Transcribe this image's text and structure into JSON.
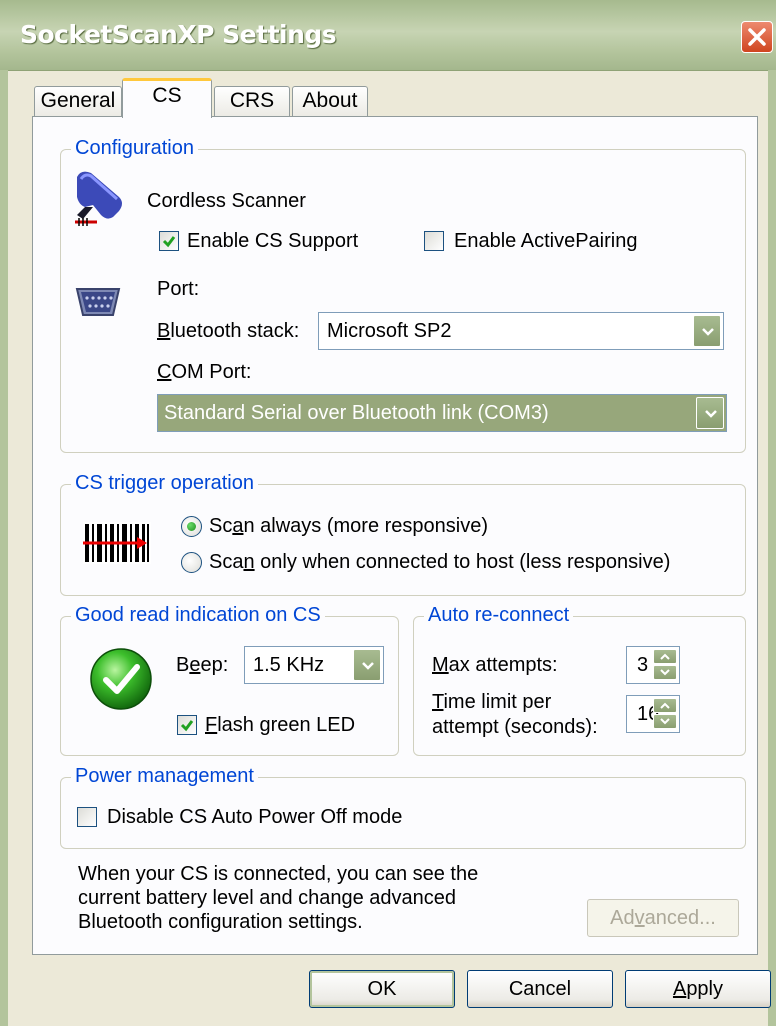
{
  "window": {
    "title": "SocketScanXP Settings",
    "close_icon": "close-icon"
  },
  "tabs": [
    {
      "label": "General",
      "active": false
    },
    {
      "label": "CS",
      "active": true
    },
    {
      "label": "CRS",
      "active": false
    },
    {
      "label": "About",
      "active": false
    }
  ],
  "configuration": {
    "title": "Configuration",
    "scanner_icon": "cordless-scanner-icon",
    "scanner_label": "Cordless Scanner",
    "enable_cs_support": {
      "label": "Enable CS Support",
      "checked": true
    },
    "enable_active_pairing": {
      "label": "Enable ActivePairing",
      "checked": false
    },
    "port_icon": "serial-port-icon",
    "port_label": "Port:",
    "bt_stack_label": "Bluetooth stack:",
    "bt_stack_value": "Microsoft SP2",
    "com_port_label": "COM Port:",
    "com_port_value": "Standard Serial over Bluetooth link (COM3)"
  },
  "trigger": {
    "title": "CS trigger operation",
    "barcode_icon": "barcode-scan-icon",
    "options": [
      {
        "label": "Scan always (more responsive)",
        "selected": true
      },
      {
        "label": "Scan only when connected to host (less responsive)",
        "selected": false
      }
    ]
  },
  "good_read": {
    "title": "Good read indication on CS",
    "icon": "green-check-icon",
    "beep_label": "Beep:",
    "beep_value": "1.5 KHz",
    "flash_led": {
      "label": "Flash green LED",
      "checked": true
    }
  },
  "auto_reconnect": {
    "title": "Auto re-connect",
    "max_attempts_label": "Max attempts:",
    "max_attempts_value": "3",
    "time_limit_label_1": "Time limit per",
    "time_limit_label_2": "attempt (seconds):",
    "time_limit_value": "16"
  },
  "power": {
    "title": "Power management",
    "disable_auto_off": {
      "label": "Disable CS Auto Power Off mode",
      "checked": false
    }
  },
  "info": {
    "lines": [
      "When your CS is connected, you can see the",
      "current battery level  and change advanced",
      "Bluetooth configuration settings."
    ],
    "advanced_label": "Advanced..."
  },
  "footer": {
    "ok_label": "OK",
    "cancel_label": "Cancel",
    "apply_label": "Apply"
  },
  "colors": {
    "group_title": "#0046d5",
    "titlebar": "#b3c49c",
    "accent_tab": "#ffc83c",
    "selection": "#97a77b"
  }
}
